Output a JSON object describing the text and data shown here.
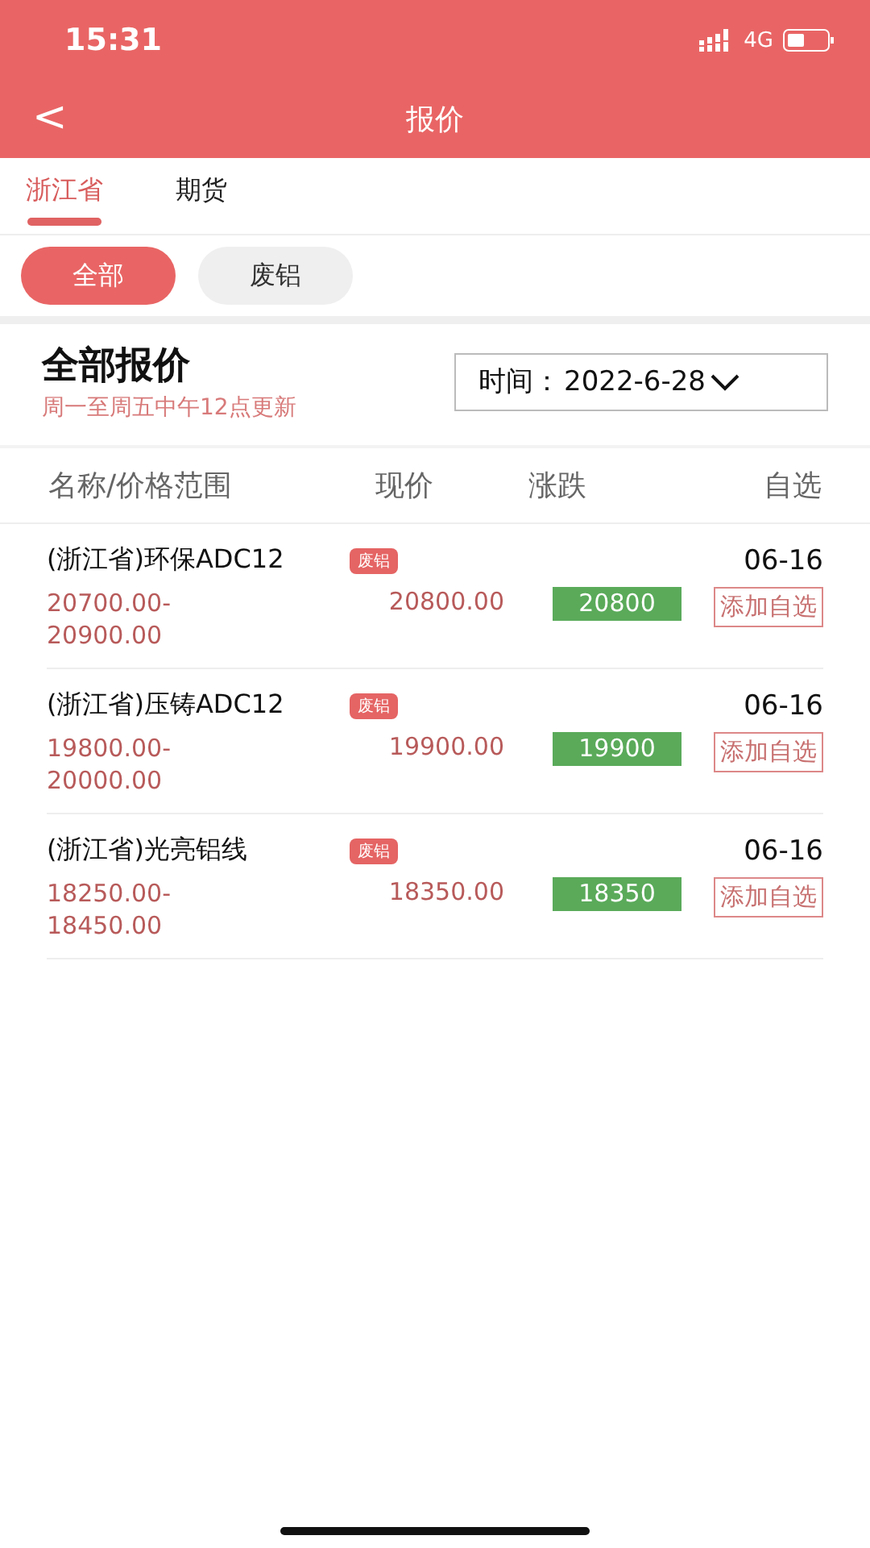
{
  "status_bar": {
    "time": "15:31",
    "network": "4G"
  },
  "nav": {
    "back": "<",
    "title": "报价"
  },
  "tabs": [
    {
      "label": "浙江省",
      "selected": true
    },
    {
      "label": "期货",
      "selected": false
    }
  ],
  "filters": [
    {
      "label": "全部",
      "selected": true
    },
    {
      "label": "废铝",
      "selected": false
    }
  ],
  "header": {
    "title": "全部报价",
    "subtitle": "周一至周五中午12点更新",
    "date_label": "时间：",
    "date_value": "2022-6-28"
  },
  "columns": [
    "名称/价格范围",
    "现价",
    "涨跌",
    "自选"
  ],
  "rows": [
    {
      "name": "(浙江省)环保ADC12",
      "tag": "废铝",
      "date": "06-16",
      "range_low": "20700.00-",
      "range_high": "20900.00",
      "price": "20800.00",
      "change": "20800",
      "action": "添加自选"
    },
    {
      "name": "(浙江省)压铸ADC12",
      "tag": "废铝",
      "date": "06-16",
      "range_low": "19800.00-",
      "range_high": "20000.00",
      "price": "19900.00",
      "change": "19900",
      "action": "添加自选"
    },
    {
      "name": "(浙江省)光亮铝线",
      "tag": "废铝",
      "date": "06-16",
      "range_low": "18250.00-",
      "range_high": "18450.00",
      "price": "18350.00",
      "change": "18350",
      "action": "添加自选"
    }
  ]
}
